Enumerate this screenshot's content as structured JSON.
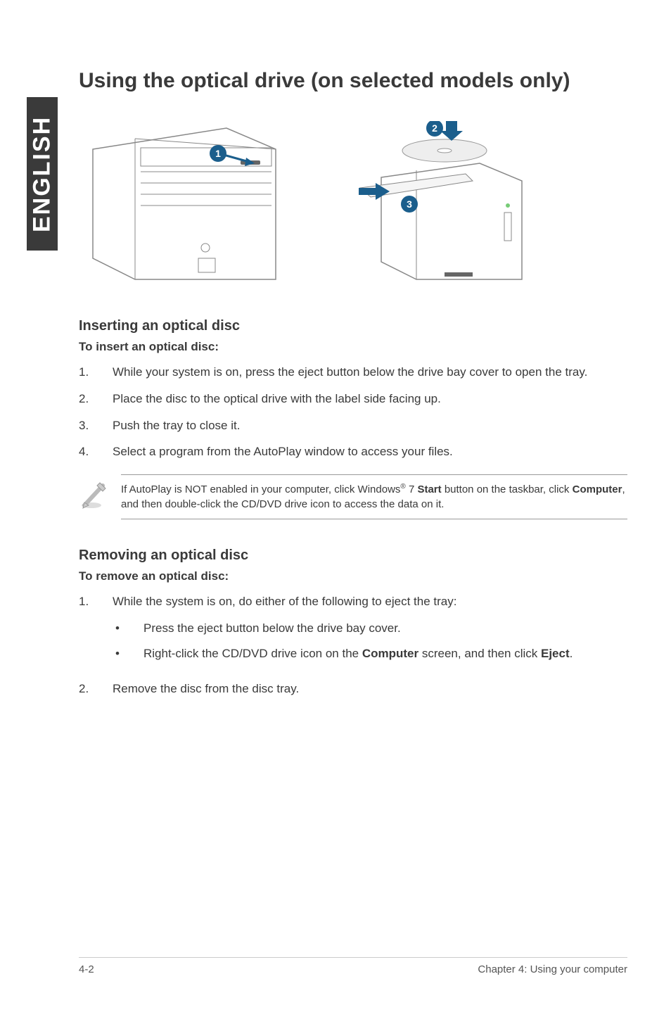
{
  "side_tab": "ENGLISH",
  "title": "Using the optical drive (on selected models only)",
  "insert": {
    "heading": "Inserting an optical disc",
    "subheading": "To insert an optical disc:",
    "steps": [
      {
        "n": "1.",
        "text": "While your system is on, press the eject button below the drive bay cover to open the tray."
      },
      {
        "n": "2.",
        "text": "Place the disc to the optical drive with the label side facing up."
      },
      {
        "n": "3.",
        "text": "Push the tray to close it."
      },
      {
        "n": "4.",
        "text": "Select a program from the AutoPlay window to access your files."
      }
    ]
  },
  "note": {
    "pre": "If AutoPlay is NOT enabled in your computer, click Windows",
    "reg": "®",
    "mid1": " 7 ",
    "bold1": "Start",
    "mid2": " button on the taskbar, click ",
    "bold2": "Computer",
    "post": ", and then double-click the CD/DVD drive icon to access the data on it."
  },
  "remove": {
    "heading": "Removing an optical disc",
    "subheading": "To remove an optical disc:",
    "step1": {
      "n": "1.",
      "text": "While the system is on, do either of the following to eject the tray:"
    },
    "bullets": [
      {
        "text": "Press the eject button below the drive bay cover."
      },
      {
        "pre": "Right-click the CD/DVD drive icon on the ",
        "bold1": "Computer",
        "mid": " screen, and then click ",
        "bold2": "Eject",
        "post": "."
      }
    ],
    "step2": {
      "n": "2.",
      "text": "Remove the disc from the disc tray."
    }
  },
  "footer": {
    "left": "4-2",
    "right": "Chapter 4: Using your computer"
  },
  "callouts": [
    "1",
    "2",
    "3"
  ]
}
